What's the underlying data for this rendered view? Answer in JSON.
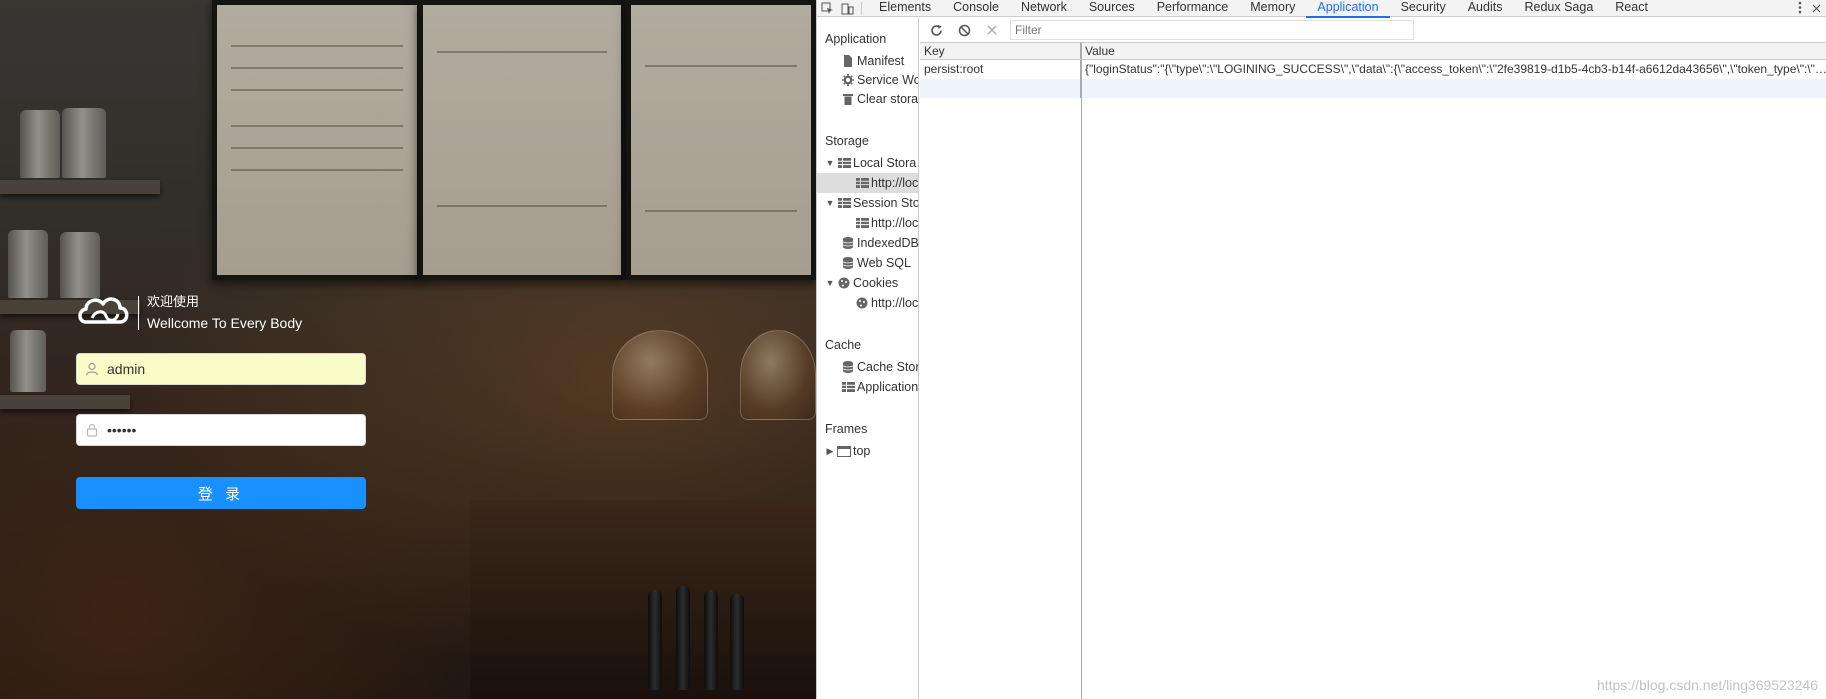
{
  "login": {
    "brand_cn": "欢迎使用",
    "brand_en": "Wellcome To Every Body",
    "username_value": "admin",
    "password_value": "••••••",
    "submit_label": "登 录",
    "accent": "#1890ff",
    "username_bg": "#fafcc8"
  },
  "devtools": {
    "tabs": [
      "Elements",
      "Console",
      "Network",
      "Sources",
      "Performance",
      "Memory",
      "Application",
      "Security",
      "Audits",
      "Redux Saga",
      "React"
    ],
    "active_tab": "Application",
    "sidebar": {
      "application_header": "Application",
      "application_items": [
        "Manifest",
        "Service Wo",
        "Clear storag"
      ],
      "storage_header": "Storage",
      "storage_items": {
        "local_storage": "Local Stora",
        "local_storage_child": "http://loc",
        "session_storage": "Session Sto",
        "session_storage_child": "http://loc",
        "indexeddb": "IndexedDB",
        "websql": "Web SQL",
        "cookies": "Cookies",
        "cookies_child": "http://loc"
      },
      "cache_header": "Cache",
      "cache_items": [
        "Cache Stora",
        "Application"
      ],
      "frames_header": "Frames",
      "frames_items": [
        "top"
      ]
    },
    "toolbar": {
      "filter_placeholder": "Filter"
    },
    "grid": {
      "key_header": "Key",
      "value_header": "Value",
      "rows": [
        {
          "key": "persist:root",
          "value": "{\"loginStatus\":\"{\\\"type\\\":\\\"LOGINING_SUCCESS\\\",\\\"data\\\":{\\\"access_token\\\":\\\"2fe39819-d1b5-4cb3-b14f-a6612da43656\\\",\\\"token_type\\\":\\\"b..."
        }
      ]
    }
  },
  "watermark": "https://blog.csdn.net/ling369523246"
}
